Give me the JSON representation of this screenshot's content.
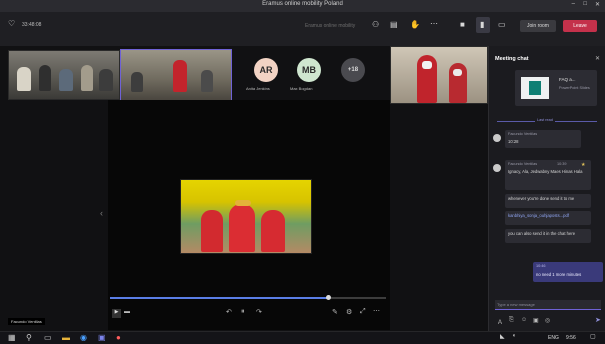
{
  "window": {
    "title": "Eramus online mobility Poland",
    "controls": [
      "–",
      "□",
      "✕"
    ]
  },
  "toolbar": {
    "timer": "33:48:08",
    "meeting_label": "Eramus online mobility",
    "icons": [
      "people-icon",
      "chat-icon",
      "raise-hand-icon",
      "more-icon",
      "camera-icon",
      "mic-icon",
      "share-icon"
    ],
    "join_label": "Join room",
    "leave_label": "Leave"
  },
  "participants": [
    {
      "initials": "AR",
      "name": "Anita Jenkins",
      "color": "#f2d3c4"
    },
    {
      "initials": "MB",
      "name": "Max Bogdan",
      "color": "#cfe6cf"
    },
    {
      "initials": "+18",
      "name": "",
      "color": "#4a4a4f"
    }
  ],
  "presenter_label": "Facundo Ventilas",
  "chat": {
    "header": "Meeting chat",
    "file_name": "FAQ a...",
    "file_meta": "PowerPoint Slides",
    "last_read": "Last read",
    "messages": [
      {
        "author": "Facundo Ventilas",
        "time": "10:28",
        "text": "10:28"
      },
      {
        "author": "Facundo Ventilas",
        "time": "10:39",
        "text": "Ignacy, Ala, Jedwabny Maes Hinas Hala"
      },
      {
        "author": "",
        "time": "",
        "text": "whenever you're done send it to me"
      },
      {
        "author": "",
        "time": "",
        "text": "kanbhiya_sonja_ouhjaposts...pdf"
      },
      {
        "author": "",
        "time": "",
        "text": "you can also send it in the chat here"
      },
      {
        "author": "",
        "time": "10:46",
        "text": "no need 1 more minutes"
      }
    ],
    "compose_placeholder": "Type a new message"
  },
  "taskbar": {
    "time": "9:56",
    "lang": "ENG"
  }
}
